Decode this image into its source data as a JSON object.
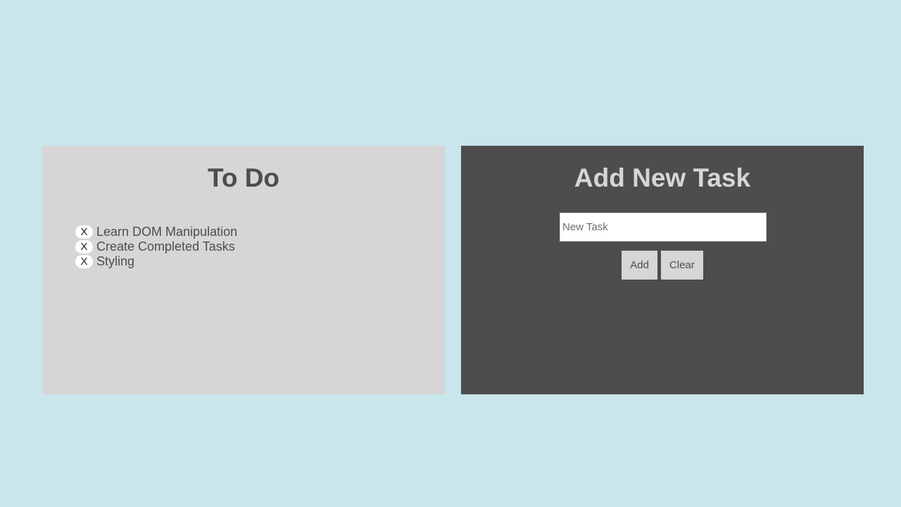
{
  "todo": {
    "title": "To Do",
    "remove_label": "X",
    "items": [
      {
        "text": "Learn DOM Manipulation"
      },
      {
        "text": "Create Completed Tasks"
      },
      {
        "text": "Styling"
      }
    ]
  },
  "add_task": {
    "title": "Add New Task",
    "input_placeholder": "New Task",
    "input_value": "",
    "add_label": "Add",
    "clear_label": "Clear"
  },
  "colors": {
    "background": "#c8e6eb",
    "light_panel": "#d6d6d6",
    "dark_panel": "#4d4d4d"
  }
}
